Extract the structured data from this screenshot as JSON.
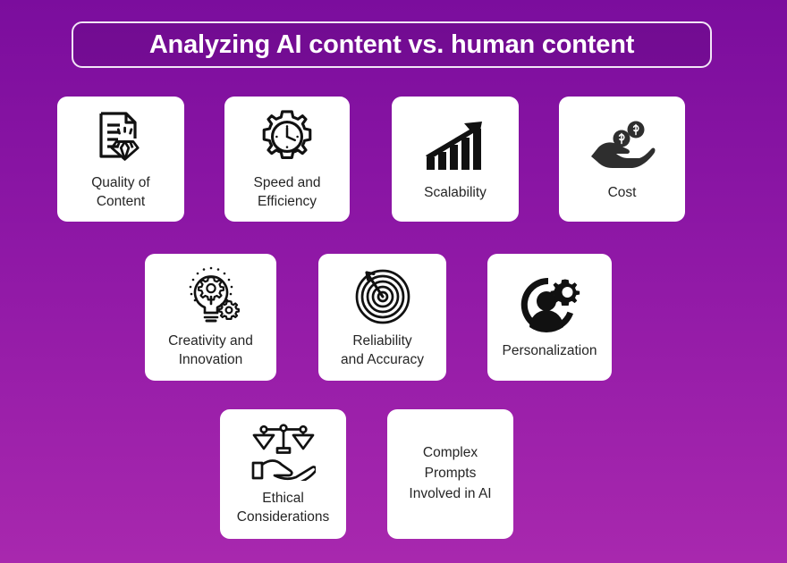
{
  "title": {
    "text": "Analyzing AI content vs. human content"
  },
  "theme": {
    "background_top": "#7b0d9d",
    "background_bottom": "#a828ae",
    "card_background": "#ffffff",
    "card_text": "#252525",
    "title_text": "#ffffff",
    "title_border": "#f2e6f7",
    "icon_color": "#111111"
  },
  "rows": [
    {
      "cards": [
        {
          "label": "Quality of\nContent",
          "icon": "document-diamond-icon",
          "has_icon": true
        },
        {
          "label": "Speed and\nEfficiency",
          "icon": "gear-clock-icon",
          "has_icon": true
        },
        {
          "label": "Scalability",
          "icon": "growth-bar-chart-icon",
          "has_icon": true
        },
        {
          "label": "Cost",
          "icon": "hand-coins-icon",
          "has_icon": true
        }
      ]
    },
    {
      "cards": [
        {
          "label": "Creativity and\nInnovation",
          "icon": "lightbulb-gear-icon",
          "has_icon": true
        },
        {
          "label": "Reliability\nand Accuracy",
          "icon": "target-arrow-icon",
          "has_icon": true
        },
        {
          "label": "Personalization",
          "icon": "user-gear-icon",
          "has_icon": true
        }
      ]
    },
    {
      "cards": [
        {
          "label": "Ethical\nConsiderations",
          "icon": "scales-hand-icon",
          "has_icon": true
        },
        {
          "label": "Complex\nPrompts\nInvolved in AI",
          "icon": "",
          "has_icon": false
        }
      ]
    }
  ]
}
